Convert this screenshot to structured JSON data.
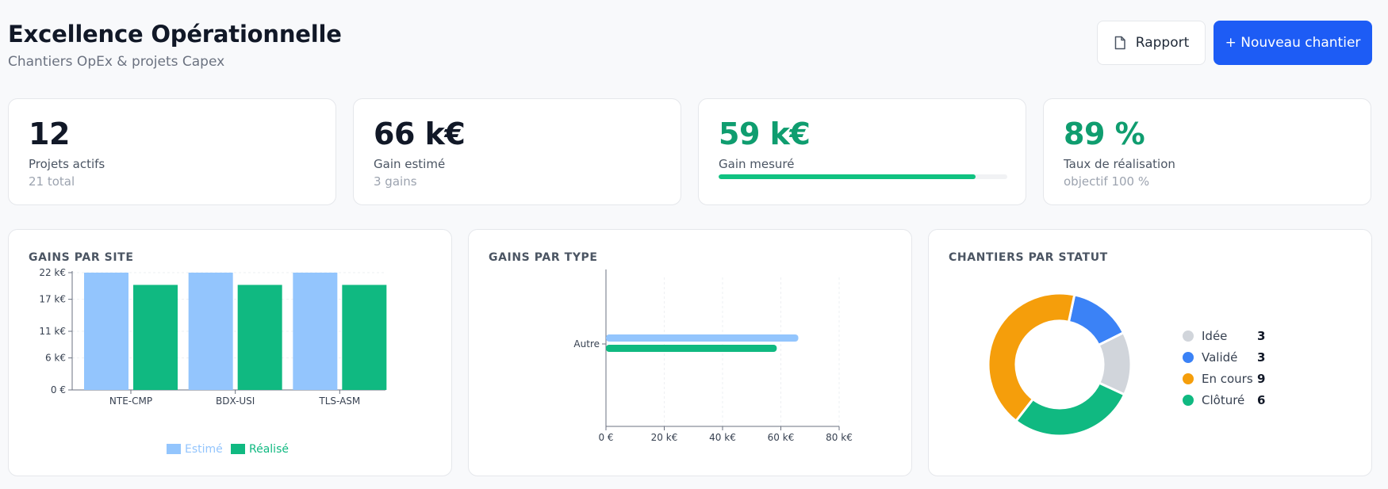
{
  "header": {
    "title": "Excellence Opérationnelle",
    "subtitle": "Chantiers OpEx & projets Capex"
  },
  "actions": {
    "report_label": "Rapport",
    "new_label": "+ Nouveau chantier"
  },
  "kpis": [
    {
      "value": "12",
      "label": "Projets actifs",
      "sub": "21 total"
    },
    {
      "value": "66 k€",
      "label": "Gain estimé",
      "sub": "3 gains"
    },
    {
      "value": "59 k€",
      "label": "Gain mesuré",
      "progress": 0.89
    },
    {
      "value": "89 %",
      "label": "Taux de réalisation",
      "sub": "objectif 100 %"
    }
  ],
  "colors": {
    "estime": "#93c5fd",
    "realise": "#10b981",
    "idee": "#d1d5db",
    "valide": "#3b82f6",
    "en_cours": "#f59e0b",
    "cloture": "#10b981",
    "primary": "#1d5cf5"
  },
  "panels": {
    "site_title": "GAINS PAR SITE",
    "type_title": "GAINS PAR TYPE",
    "status_title": "CHANTIERS PAR STATUT"
  },
  "chart_data": [
    {
      "type": "bar",
      "title": "GAINS PAR SITE",
      "categories": [
        "NTE-CMP",
        "BDX-USI",
        "TLS-ASM"
      ],
      "series": [
        {
          "name": "Estimé",
          "values": [
            22,
            22,
            22
          ]
        },
        {
          "name": "Réalisé",
          "values": [
            19.7,
            19.7,
            19.7
          ]
        }
      ],
      "ylim": [
        0,
        22
      ],
      "yticks": [
        0,
        6,
        11,
        17,
        22
      ],
      "ytick_labels": [
        "0 €",
        "6 k€",
        "11 k€",
        "17 k€",
        "22 k€"
      ],
      "legend": "bottom",
      "grid": true
    },
    {
      "type": "bar",
      "orientation": "horizontal",
      "title": "GAINS PAR TYPE",
      "categories": [
        "Autre"
      ],
      "series": [
        {
          "name": "Estimé",
          "values": [
            66
          ]
        },
        {
          "name": "Réalisé",
          "values": [
            58.6
          ]
        }
      ],
      "xlim": [
        0,
        80
      ],
      "xticks": [
        0,
        20,
        40,
        60,
        80
      ],
      "xtick_labels": [
        "0 €",
        "20 k€",
        "40 k€",
        "60 k€",
        "80 k€"
      ],
      "grid": true
    },
    {
      "type": "pie",
      "title": "CHANTIERS PAR STATUT",
      "donut": true,
      "labels": [
        "Idée",
        "Validé",
        "En cours",
        "Clôturé"
      ],
      "values": [
        3,
        3,
        9,
        6
      ],
      "legend": "right"
    }
  ]
}
